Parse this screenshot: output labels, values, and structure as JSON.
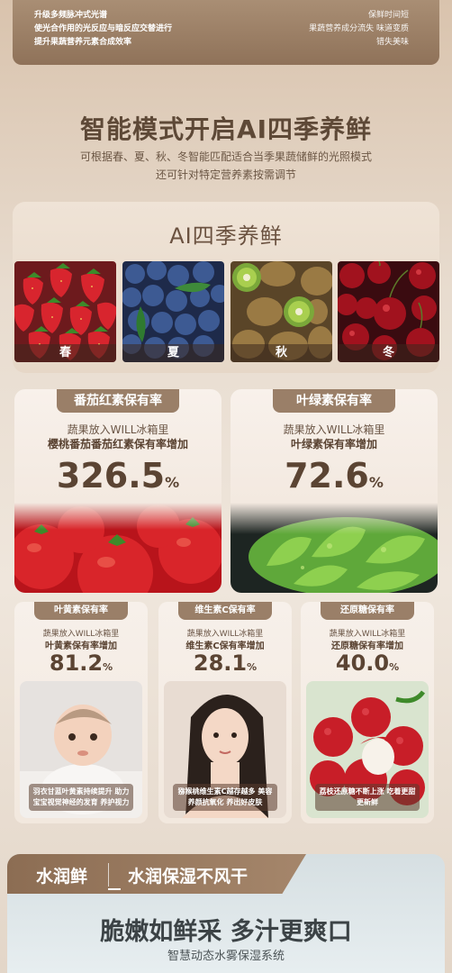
{
  "top": {
    "left_lines": [
      "升级多频脉冲式光谱",
      "使光合作用的光反应与暗反应交替进行",
      "提升果蔬营养元素合成效率"
    ],
    "right_lines": [
      "保鲜时间短",
      "果蔬营养成分流失 味道变质",
      "错失美味"
    ]
  },
  "headline": {
    "title": "智能模式开启AI四季养鲜",
    "sub_line1": "可根据春、夏、秋、冬智能匹配适合当季果蔬储鲜的光照模式",
    "sub_line2": "还可针对特定营养素按需调节"
  },
  "seasons": {
    "title": "AI四季养鲜",
    "items": [
      {
        "label": "春",
        "icon": "strawberry-icon"
      },
      {
        "label": "夏",
        "icon": "blueberry-icon"
      },
      {
        "label": "秋",
        "icon": "kiwi-icon"
      },
      {
        "label": "冬",
        "icon": "cherry-icon"
      }
    ]
  },
  "big_cards": [
    {
      "pill": "番茄红素保有率",
      "line1": "蔬果放入WILL冰箱里",
      "line2": "樱桃番茄番茄红素保有率增加",
      "value": "326.5",
      "unit": "%"
    },
    {
      "pill": "叶绿素保有率",
      "line1": "蔬果放入WILL冰箱里",
      "line2": "叶绿素保有率增加",
      "value": "72.6",
      "unit": "%"
    }
  ],
  "small_cards": [
    {
      "pill": "叶黄素保有率",
      "line1": "蔬果放入WILL冰箱里",
      "line2": "叶黄素保有率增加",
      "value": "81.2",
      "unit": "%",
      "caption": "羽衣甘蓝叶黄素持续提升 助力宝宝视觉神经的发育 养护视力"
    },
    {
      "pill": "维生素C保有率",
      "line1": "蔬果放入WILL冰箱里",
      "line2": "维生素C保有率增加",
      "value": "28.1",
      "unit": "%",
      "caption": "猕猴桃维生素C越存越多 美容养颜抗氧化 养出好皮肤"
    },
    {
      "pill": "还原糖保有率",
      "line1": "蔬果放入WILL冰箱里",
      "line2": "还原糖保有率增加",
      "value": "40.0",
      "unit": "%",
      "caption": "荔枝还原糖不断上涨 吃着更甜更新鲜"
    }
  ],
  "bottom": {
    "tab1": "水润鲜",
    "tab2": "水润保湿不风干",
    "title": "脆嫩如鲜采 多汁更爽口",
    "sub": "智慧动态水雾保湿系统"
  }
}
